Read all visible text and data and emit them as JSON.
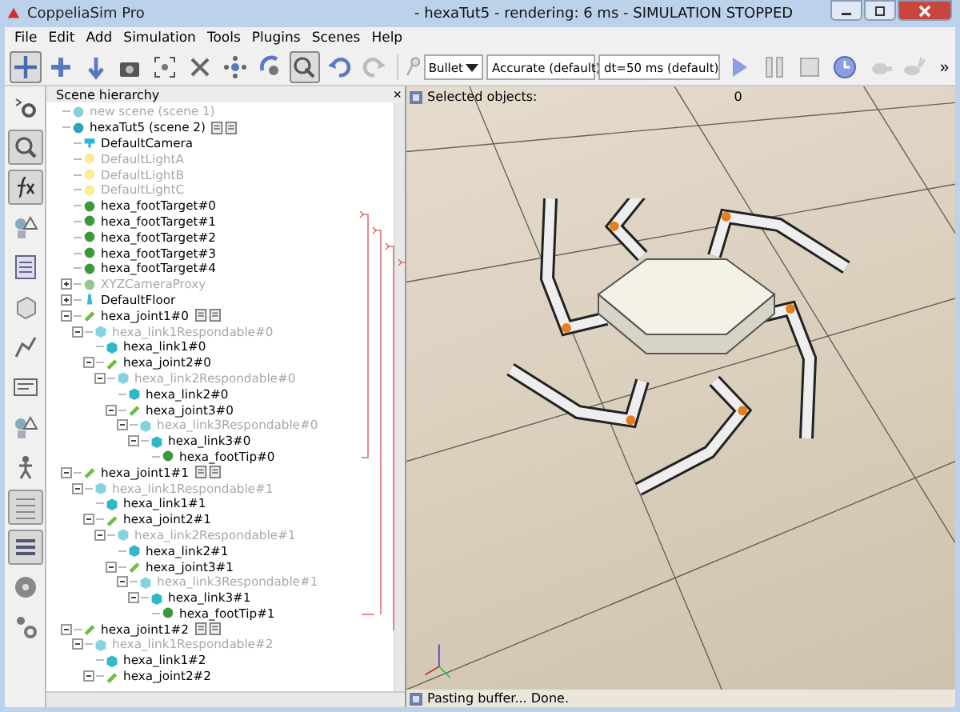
{
  "window": {
    "app_name": "CoppeliaSim Pro",
    "title": "- hexaTut5 - rendering: 6 ms - SIMULATION STOPPED"
  },
  "menu": [
    "File",
    "Edit",
    "Add",
    "Simulation",
    "Tools",
    "Plugins",
    "Scenes",
    "Help"
  ],
  "toolbar": {
    "tools": [
      {
        "kind": "move",
        "selected": true
      },
      {
        "kind": "rotate",
        "selected": false
      },
      {
        "kind": "down",
        "selected": false
      },
      {
        "kind": "camera",
        "selected": false
      },
      {
        "kind": "fit",
        "selected": false
      },
      {
        "kind": "fly",
        "selected": false
      },
      {
        "kind": "shift",
        "selected": false
      },
      {
        "kind": "orbit",
        "selected": false
      },
      {
        "kind": "select",
        "selected": true
      },
      {
        "kind": "undo",
        "selected": false
      },
      {
        "kind": "redo",
        "selected": false
      }
    ],
    "dropdowns": [
      "Bullet",
      "Accurate (default)",
      "dt=50 ms (default)"
    ],
    "sim_buttons": [
      {
        "kind": "play"
      },
      {
        "kind": "pause"
      },
      {
        "kind": "stop"
      },
      {
        "kind": "clock"
      },
      {
        "kind": "turtle"
      },
      {
        "kind": "rabbit"
      }
    ],
    "more": "»"
  },
  "sidebar": {
    "items": [
      {
        "kind": "gear",
        "selected": false
      },
      {
        "kind": "search",
        "selected": true
      },
      {
        "kind": "fx",
        "selected": true
      },
      {
        "kind": "shapes",
        "selected": false
      },
      {
        "kind": "calc",
        "selected": false
      },
      {
        "kind": "cube",
        "selected": false
      },
      {
        "kind": "graph",
        "selected": false
      },
      {
        "kind": "script",
        "selected": false
      },
      {
        "kind": "shapes",
        "selected": false
      },
      {
        "kind": "person",
        "selected": false
      },
      {
        "kind": "list",
        "selected": true
      },
      {
        "kind": "layers",
        "selected": true
      },
      {
        "kind": "film",
        "selected": false
      },
      {
        "kind": "usergear",
        "selected": false
      }
    ]
  },
  "hierarchy": {
    "title": "Scene hierarchy",
    "close": "×",
    "tree": [
      {
        "label": "new scene (scene 1)",
        "kind": "scene",
        "disabled": true
      },
      {
        "label": "hexaTut5 (scene 2)",
        "kind": "scene",
        "disabled": false,
        "scripts": true,
        "children": [
          {
            "label": "DefaultCamera",
            "kind": "camera",
            "disabled": false
          },
          {
            "label": "DefaultLightA",
            "kind": "light",
            "disabled": true
          },
          {
            "label": "DefaultLightB",
            "kind": "light",
            "disabled": true
          },
          {
            "label": "DefaultLightC",
            "kind": "light",
            "disabled": true
          },
          {
            "label": "hexa_footTarget#0",
            "kind": "dummy",
            "disabled": false
          },
          {
            "label": "hexa_footTarget#1",
            "kind": "dummy",
            "disabled": false
          },
          {
            "label": "hexa_footTarget#2",
            "kind": "dummy",
            "disabled": false
          },
          {
            "label": "hexa_footTarget#3",
            "kind": "dummy",
            "disabled": false
          },
          {
            "label": "hexa_footTarget#4",
            "kind": "dummy",
            "disabled": false
          },
          {
            "label": "XYZCameraProxy",
            "kind": "dummy",
            "disabled": true,
            "expanded": false
          },
          {
            "label": "DefaultFloor",
            "kind": "floor",
            "disabled": false,
            "expanded": false
          },
          {
            "label": "hexa_joint1#0",
            "kind": "joint",
            "disabled": false,
            "scripts": true,
            "expanded": true,
            "children": [
              {
                "label": "hexa_link1Respondable#0",
                "kind": "shape",
                "disabled": true,
                "expanded": true,
                "children": [
                  {
                    "label": "hexa_link1#0",
                    "kind": "shape",
                    "disabled": false
                  },
                  {
                    "label": "hexa_joint2#0",
                    "kind": "joint",
                    "disabled": false,
                    "expanded": true,
                    "children": [
                      {
                        "label": "hexa_link2Respondable#0",
                        "kind": "shape",
                        "disabled": true,
                        "expanded": true,
                        "children": [
                          {
                            "label": "hexa_link2#0",
                            "kind": "shape",
                            "disabled": false
                          },
                          {
                            "label": "hexa_joint3#0",
                            "kind": "joint",
                            "disabled": false,
                            "expanded": true,
                            "children": [
                              {
                                "label": "hexa_link3Respondable#0",
                                "kind": "shape",
                                "disabled": true,
                                "expanded": true,
                                "children": [
                                  {
                                    "label": "hexa_link3#0",
                                    "kind": "shape",
                                    "disabled": false,
                                    "expanded": true,
                                    "children": [
                                      {
                                        "label": "hexa_footTip#0",
                                        "kind": "dummy",
                                        "disabled": false
                                      }
                                    ]
                                  }
                                ]
                              }
                            ]
                          }
                        ]
                      }
                    ]
                  }
                ]
              }
            ]
          },
          {
            "label": "hexa_joint1#1",
            "kind": "joint",
            "disabled": false,
            "scripts": true,
            "expanded": true,
            "children": [
              {
                "label": "hexa_link1Respondable#1",
                "kind": "shape",
                "disabled": true,
                "expanded": true,
                "children": [
                  {
                    "label": "hexa_link1#1",
                    "kind": "shape",
                    "disabled": false
                  },
                  {
                    "label": "hexa_joint2#1",
                    "kind": "joint",
                    "disabled": false,
                    "expanded": true,
                    "children": [
                      {
                        "label": "hexa_link2Respondable#1",
                        "kind": "shape",
                        "disabled": true,
                        "expanded": true,
                        "children": [
                          {
                            "label": "hexa_link2#1",
                            "kind": "shape",
                            "disabled": false
                          },
                          {
                            "label": "hexa_joint3#1",
                            "kind": "joint",
                            "disabled": false,
                            "expanded": true,
                            "children": [
                              {
                                "label": "hexa_link3Respondable#1",
                                "kind": "shape",
                                "disabled": true,
                                "expanded": true,
                                "children": [
                                  {
                                    "label": "hexa_link3#1",
                                    "kind": "shape",
                                    "disabled": false,
                                    "expanded": true,
                                    "children": [
                                      {
                                        "label": "hexa_footTip#1",
                                        "kind": "dummy",
                                        "disabled": false
                                      }
                                    ]
                                  }
                                ]
                              }
                            ]
                          }
                        ]
                      }
                    ]
                  }
                ]
              }
            ]
          },
          {
            "label": "hexa_joint1#2",
            "kind": "joint",
            "disabled": false,
            "scripts": true,
            "expanded": true,
            "children": [
              {
                "label": "hexa_link1Respondable#2",
                "kind": "shape",
                "disabled": true,
                "expanded": true,
                "children": [
                  {
                    "label": "hexa_link1#2",
                    "kind": "shape",
                    "disabled": false
                  },
                  {
                    "label": "hexa_joint2#2",
                    "kind": "joint",
                    "disabled": false,
                    "expanded": true
                  }
                ]
              }
            ]
          }
        ]
      }
    ]
  },
  "viewport": {
    "selected_label": "Selected objects:",
    "selected_count": "0"
  },
  "status_bar": "Pasting buffer... Done."
}
